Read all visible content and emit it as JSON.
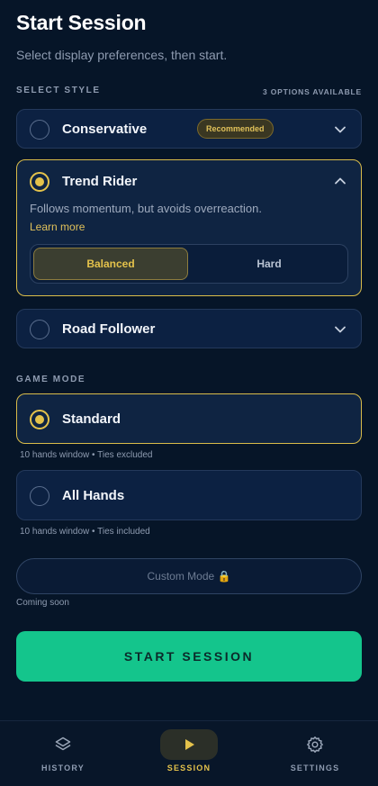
{
  "header": {
    "title": "Start Session",
    "subtitle": "Select display preferences, then start."
  },
  "style_section": {
    "label": "SELECT STYLE",
    "options_count": "3 OPTIONS AVAILABLE",
    "options": [
      {
        "title": "Conservative",
        "badge": "Recommended",
        "selected": false,
        "expanded": false
      },
      {
        "title": "Trend Rider",
        "selected": true,
        "expanded": true,
        "description": "Follows momentum, but avoids overreaction.",
        "learn_more": "Learn more",
        "difficulty": {
          "options": [
            "Balanced",
            "Hard"
          ],
          "selected": "Balanced"
        }
      },
      {
        "title": "Road Follower",
        "selected": false,
        "expanded": false
      }
    ]
  },
  "mode_section": {
    "label": "GAME MODE",
    "modes": [
      {
        "title": "Standard",
        "selected": true,
        "hint": "10 hands window • Ties excluded"
      },
      {
        "title": "All Hands",
        "selected": false,
        "hint": "10 hands window • Ties included"
      }
    ],
    "custom": {
      "label": "Custom Mode 🔒",
      "note": "Coming soon",
      "disabled": true
    }
  },
  "start_button": "START SESSION",
  "nav": {
    "items": [
      {
        "label": "HISTORY",
        "icon": "layers-icon",
        "active": false
      },
      {
        "label": "SESSION",
        "icon": "play-icon",
        "active": true
      },
      {
        "label": "SETTINGS",
        "icon": "gear-icon",
        "active": false
      }
    ]
  },
  "colors": {
    "background": "#061528",
    "accent": "#e4c24b",
    "primary_button": "#14c58c",
    "card": "#0c2142"
  }
}
